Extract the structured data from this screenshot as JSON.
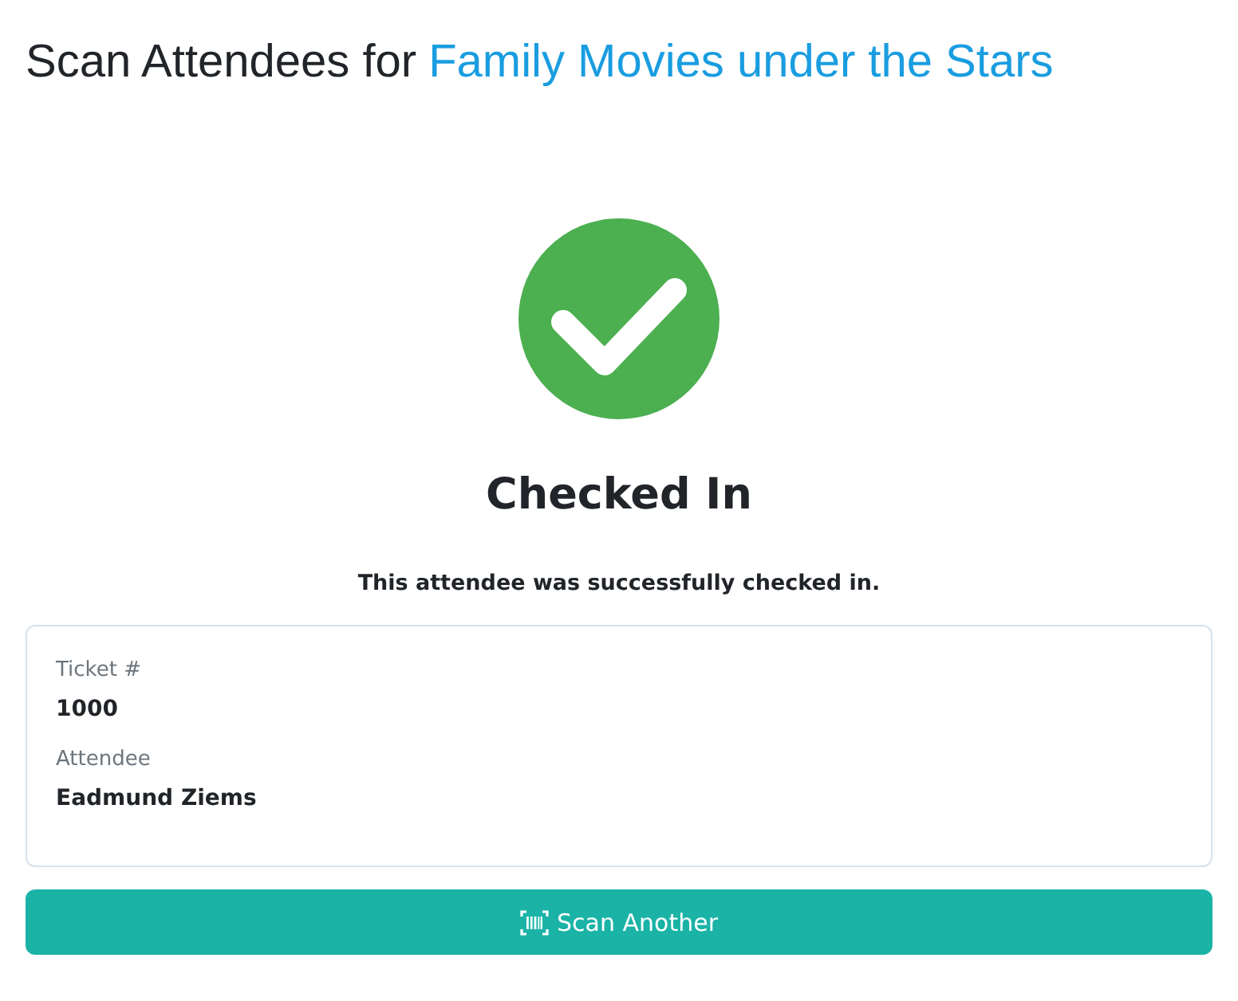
{
  "page_title": {
    "text": "Scan Attendees for",
    "event_link": "Family Movies under the Stars"
  },
  "result": {
    "kind": "success",
    "heading": "Checked In",
    "message": "This attendee was successfully checked in."
  },
  "details": [
    {
      "label": "Ticket #",
      "value": "1000"
    },
    {
      "label": "Attendee",
      "value": "Eadmund Ziems"
    }
  ],
  "action_button": {
    "label": "Scan Another"
  }
}
